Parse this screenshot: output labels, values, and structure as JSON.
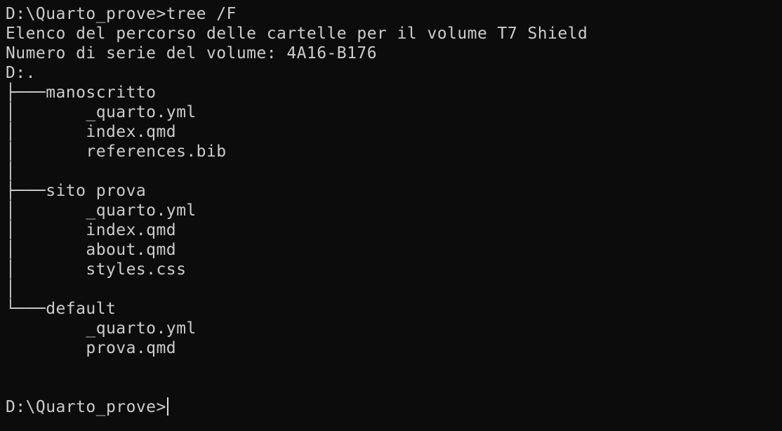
{
  "terminal": {
    "command_prompt": "D:\\Quarto_prove>",
    "command": "tree /F",
    "header_line1": "Elenco del percorso delle cartelle per il volume T7 Shield",
    "header_line2": "Numero di serie del volume: 4A16-B176",
    "root": "D:.",
    "folders": [
      {
        "branch": "├───",
        "name": "manoscritto",
        "files": [
          "_quarto.yml",
          "index.qmd",
          "references.bib"
        ],
        "gap": "│"
      },
      {
        "branch": "├───",
        "name": "sito prova",
        "files": [
          "_quarto.yml",
          "index.qmd",
          "about.qmd",
          "styles.css"
        ],
        "gap": "│"
      },
      {
        "branch": "└───",
        "name": "default",
        "files": [
          "_quarto.yml",
          "prova.qmd"
        ],
        "gap": ""
      }
    ],
    "file_prefix_continue": "│       ",
    "file_prefix_last": "        ",
    "final_prompt": "D:\\Quarto_prove>"
  },
  "colors": {
    "background": "#0c0c0c",
    "text": "#cccccc"
  }
}
